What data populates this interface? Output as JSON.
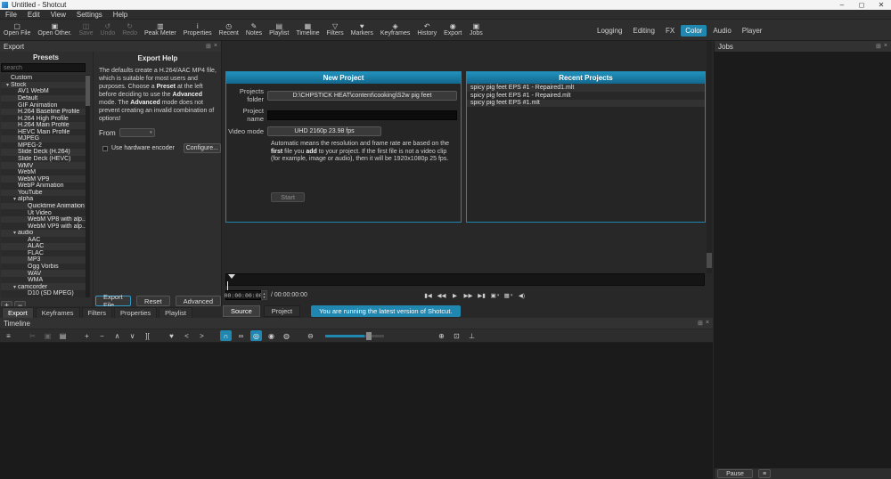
{
  "window": {
    "title": "Untitled - Shotcut",
    "minimize": "–",
    "maximize": "◻",
    "close": "✕"
  },
  "menu": {
    "items": [
      "File",
      "Edit",
      "View",
      "Settings",
      "Help"
    ]
  },
  "toolbar": {
    "left": [
      {
        "label": "Open File",
        "icon": "▢"
      },
      {
        "label": "Open Other.",
        "icon": "▣"
      },
      {
        "label": "Save",
        "icon": "◫",
        "disabled": true
      },
      {
        "label": "Undo",
        "icon": "↺",
        "disabled": true
      },
      {
        "label": "Redo",
        "icon": "↻",
        "disabled": true
      },
      {
        "label": "Peak Meter",
        "icon": "▥"
      },
      {
        "label": "Properties",
        "icon": "i"
      },
      {
        "label": "Recent",
        "icon": "◷"
      },
      {
        "label": "Notes",
        "icon": "✎"
      },
      {
        "label": "Playlist",
        "icon": "▤"
      },
      {
        "label": "Timeline",
        "icon": "▦"
      },
      {
        "label": "Filters",
        "icon": "▽"
      },
      {
        "label": "Markers",
        "icon": "♥"
      },
      {
        "label": "Keyframes",
        "icon": "◈"
      },
      {
        "label": "History",
        "icon": "↶"
      },
      {
        "label": "Export",
        "icon": "◉"
      },
      {
        "label": "Jobs",
        "icon": "▣"
      }
    ],
    "right": [
      {
        "label": "Logging"
      },
      {
        "label": "Editing"
      },
      {
        "label": "FX"
      },
      {
        "label": "Color",
        "active": true
      },
      {
        "label": "Audio"
      },
      {
        "label": "Player"
      }
    ]
  },
  "export_dock": {
    "title": "Export",
    "float_icon": "⊞",
    "close_icon": "×",
    "presets": {
      "title": "Presets",
      "search_placeholder": "search",
      "items": [
        {
          "arrow": "",
          "label": "Custom"
        },
        {
          "arrow": "▾",
          "label": "Stock"
        },
        {
          "arrow": "",
          "label": "AV1 WebM"
        },
        {
          "arrow": "",
          "label": "Default"
        },
        {
          "arrow": "",
          "label": "GIF Animation"
        },
        {
          "arrow": "",
          "label": "H.264 Baseline Profile"
        },
        {
          "arrow": "",
          "label": "H.264 High Profile"
        },
        {
          "arrow": "",
          "label": "H.264 Main Profile"
        },
        {
          "arrow": "",
          "label": "HEVC Main Profile"
        },
        {
          "arrow": "",
          "label": "MJPEG"
        },
        {
          "arrow": "",
          "label": "MPEG-2"
        },
        {
          "arrow": "",
          "label": "Slide Deck (H.264)"
        },
        {
          "arrow": "",
          "label": "Slide Deck (HEVC)"
        },
        {
          "arrow": "",
          "label": "WMV"
        },
        {
          "arrow": "",
          "label": "WebM"
        },
        {
          "arrow": "",
          "label": "WebM VP9"
        },
        {
          "arrow": "",
          "label": "WebP Animation"
        },
        {
          "arrow": "",
          "label": "YouTube"
        },
        {
          "arrow": "▾",
          "label": "alpha"
        },
        {
          "arrow": "",
          "label": "Quicktime Animation"
        },
        {
          "arrow": "",
          "label": "Ut Video"
        },
        {
          "arrow": "",
          "label": "WebM VP8 with alp..."
        },
        {
          "arrow": "",
          "label": "WebM VP9 with alp..."
        },
        {
          "arrow": "▾",
          "label": "audio"
        },
        {
          "arrow": "",
          "label": "AAC"
        },
        {
          "arrow": "",
          "label": "ALAC"
        },
        {
          "arrow": "",
          "label": "FLAC"
        },
        {
          "arrow": "",
          "label": "MP3"
        },
        {
          "arrow": "",
          "label": "Ogg Vorbis"
        },
        {
          "arrow": "",
          "label": "WAV"
        },
        {
          "arrow": "",
          "label": "WMA"
        },
        {
          "arrow": "▾",
          "label": "camcorder"
        },
        {
          "arrow": "",
          "label": "D10 (SD MPEG)"
        }
      ]
    },
    "add_label": "+",
    "remove_label": "−",
    "help": {
      "title": "Export Help",
      "p1": "The defaults create a H.264/AAC MP4 file, which is suitable for most users and purposes. Choose a ",
      "b1": "Preset",
      "p2": " at the left before deciding to use the ",
      "b2": "Advanced",
      "p3": " mode. The ",
      "b3": "Advanced",
      "p4": " mode does not prevent creating an invalid combination of options!",
      "from_label": "From",
      "from_caret": "▾",
      "hardware_label": "Use hardware encoder",
      "configure_label": "Configure..."
    },
    "buttons": {
      "export_file": "Export File",
      "reset": "Reset",
      "advanced": "Advanced"
    },
    "tabs": [
      {
        "label": "Export",
        "active": true
      },
      {
        "label": "Keyframes"
      },
      {
        "label": "Filters"
      },
      {
        "label": "Properties"
      },
      {
        "label": "Playlist"
      }
    ]
  },
  "player": {
    "new_project": {
      "title": "New Project",
      "projects_folder_label": "Projects folder",
      "projects_folder_value": "D:\\CHPSTICK HEAT\\content\\cooking\\S2w pig feet",
      "project_name_label": "Project name",
      "video_mode_label": "Video mode",
      "video_mode_value": "UHD 2160p 23.98 fps",
      "note_p1": "Automatic means the resolution and frame rate are based on the ",
      "note_b1": "first",
      "note_p2": " file you ",
      "note_b2": "add",
      "note_p3": " to your project. If the first file is not a video clip (for example, image or audio), then it will be 1920x1080p 25 fps.",
      "start_label": "Start"
    },
    "recent_projects": {
      "title": "Recent Projects",
      "items": [
        "spicy pig feet  EPS #1 - Repaired1.mlt",
        "spicy pig feet  EPS #1 - Repaired.mlt",
        "spicy pig feet  EPS #1.mlt"
      ]
    },
    "transport": {
      "current_time": "00:00:00:00",
      "spin_up": "▴",
      "spin_down": "▾",
      "duration": "/ 00:00:00:00",
      "buttons": [
        {
          "name": "skip-to-start",
          "glyph": "▮◀"
        },
        {
          "name": "rewind",
          "glyph": "◀◀"
        },
        {
          "name": "play",
          "glyph": "▶"
        },
        {
          "name": "fast-forward",
          "glyph": "▶▶"
        },
        {
          "name": "skip-to-end",
          "glyph": "▶▮"
        },
        {
          "name": "in-out-range",
          "glyph": "▣",
          "caret": "▾"
        },
        {
          "name": "grid",
          "glyph": "▦",
          "caret": "▾"
        },
        {
          "name": "volume",
          "glyph": "◀)"
        }
      ]
    },
    "tabs": [
      {
        "label": "Source",
        "active": true
      },
      {
        "label": "Project"
      }
    ],
    "status_message": "You are running the latest version of Shotcut."
  },
  "jobs_dock": {
    "title": "Jobs",
    "float_icon": "⊞",
    "close_icon": "×",
    "pause_label": "Pause",
    "menu_icon": "≡"
  },
  "timeline_dock": {
    "title": "Timeline",
    "float_icon": "⊞",
    "close_icon": "×",
    "tools": [
      {
        "name": "timeline-menu",
        "glyph": "≡"
      },
      {
        "name": "cut",
        "glyph": "✂",
        "disabled": true
      },
      {
        "name": "copy",
        "glyph": "▣",
        "disabled": true
      },
      {
        "name": "paste",
        "glyph": "▤"
      },
      {
        "name": "append",
        "glyph": "+"
      },
      {
        "name": "ripple-delete",
        "glyph": "−"
      },
      {
        "name": "lift",
        "glyph": "∧"
      },
      {
        "name": "overwrite",
        "glyph": "∨"
      },
      {
        "name": "split",
        "glyph": "]["
      },
      {
        "name": "marker",
        "glyph": "♥"
      },
      {
        "name": "prev-marker",
        "glyph": "<"
      },
      {
        "name": "next-marker",
        "glyph": ">"
      },
      {
        "name": "snap",
        "glyph": "∩",
        "active": true
      },
      {
        "name": "scrub-while-dragging",
        "glyph": "∞"
      },
      {
        "name": "ripple",
        "glyph": "◎",
        "active": true
      },
      {
        "name": "ripple-all-tracks",
        "glyph": "◉"
      },
      {
        "name": "ripple-markers",
        "glyph": "◍"
      },
      {
        "name": "zoom-out",
        "glyph": "⊖"
      },
      {
        "name": "zoom-in",
        "glyph": "⊕"
      },
      {
        "name": "zoom-fit",
        "glyph": "⊡"
      },
      {
        "name": "record-audio",
        "glyph": "⊥"
      }
    ]
  },
  "colors": {
    "accent": "#1f87b0",
    "header_top": "#2191bd",
    "header_bottom": "#14678c"
  }
}
